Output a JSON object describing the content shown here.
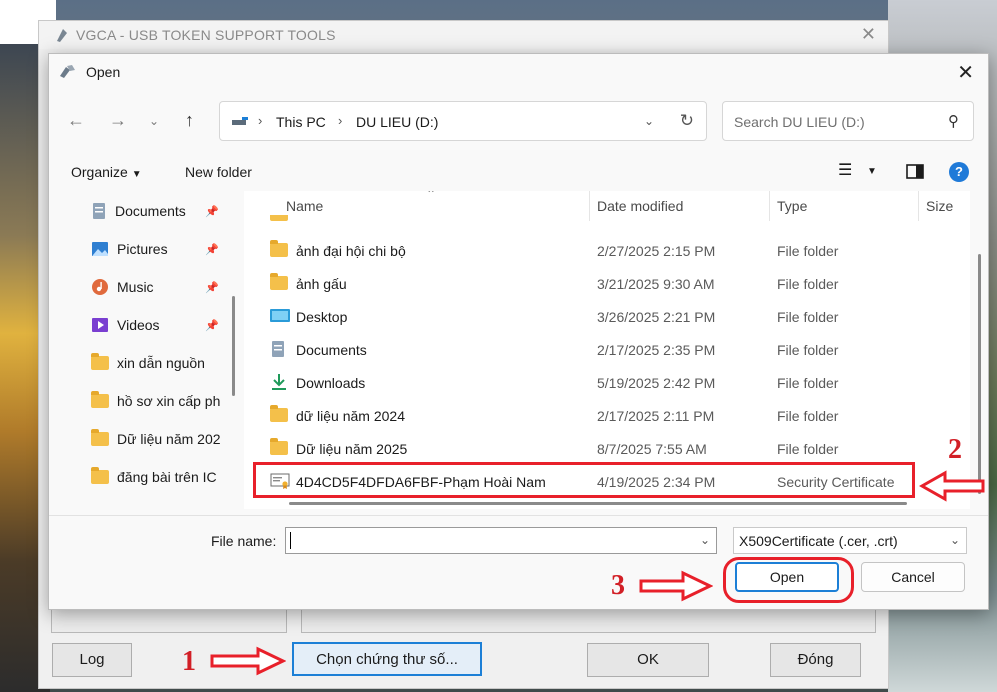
{
  "parent_window": {
    "title": "VGCA - USB TOKEN SUPPORT TOOLS",
    "buttons": {
      "log": "Log",
      "choose_cert": "Chọn chứng thư số...",
      "ok": "OK",
      "close": "Đóng"
    }
  },
  "dialog": {
    "title": "Open",
    "address": {
      "crumbs": [
        "This PC",
        "DU LIEU (D:)"
      ]
    },
    "search_placeholder": "Search DU LIEU (D:)",
    "toolbar": {
      "organize": "Organize",
      "new_folder": "New folder"
    },
    "nav_items": [
      {
        "label": "Documents",
        "icon": "documents-icon",
        "pinned": true
      },
      {
        "label": "Pictures",
        "icon": "pictures-icon",
        "pinned": true
      },
      {
        "label": "Music",
        "icon": "music-icon",
        "pinned": true
      },
      {
        "label": "Videos",
        "icon": "videos-icon",
        "pinned": true
      },
      {
        "label": "xin dẫn nguồn",
        "icon": "folder-icon",
        "pinned": false
      },
      {
        "label": "hồ sơ xin cấp ph",
        "icon": "folder-icon",
        "pinned": false
      },
      {
        "label": "Dữ liệu năm 202",
        "icon": "folder-icon",
        "pinned": false
      },
      {
        "label": "đăng bài trên IC",
        "icon": "folder-icon",
        "pinned": false
      }
    ],
    "columns": {
      "name": "Name",
      "date": "Date modified",
      "type": "Type",
      "size": "Size"
    },
    "files": [
      {
        "name": "ảnh đại hội chi bộ",
        "date": "2/27/2025 2:15 PM",
        "type": "File folder",
        "icon": "folder-icon"
      },
      {
        "name": "ảnh gấu",
        "date": "3/21/2025 9:30 AM",
        "type": "File folder",
        "icon": "folder-icon"
      },
      {
        "name": "Desktop",
        "date": "3/26/2025 2:21 PM",
        "type": "File folder",
        "icon": "desktop-icon"
      },
      {
        "name": "Documents",
        "date": "2/17/2025 2:35 PM",
        "type": "File folder",
        "icon": "documents-icon"
      },
      {
        "name": "Downloads",
        "date": "5/19/2025 2:42 PM",
        "type": "File folder",
        "icon": "downloads-icon"
      },
      {
        "name": "dữ liệu năm 2024",
        "date": "2/17/2025 2:11 PM",
        "type": "File folder",
        "icon": "folder-icon"
      },
      {
        "name": "Dữ liệu năm 2025",
        "date": "8/7/2025 7:55 AM",
        "type": "File folder",
        "icon": "folder-icon"
      },
      {
        "name": "4D4CD5F4DFDA6FBF-Phạm Hoài Nam",
        "date": "4/19/2025 2:34 PM",
        "type": "Security Certificate",
        "icon": "certificate-icon"
      }
    ],
    "file_name_label": "File name:",
    "file_name_value": "",
    "filter": "X509Certificate (.cer, .crt)",
    "open_label": "Open",
    "cancel_label": "Cancel"
  },
  "annotations": [
    "1",
    "2",
    "3"
  ],
  "colors": {
    "highlight": "#e8202a",
    "accent": "#1c7fd6"
  }
}
